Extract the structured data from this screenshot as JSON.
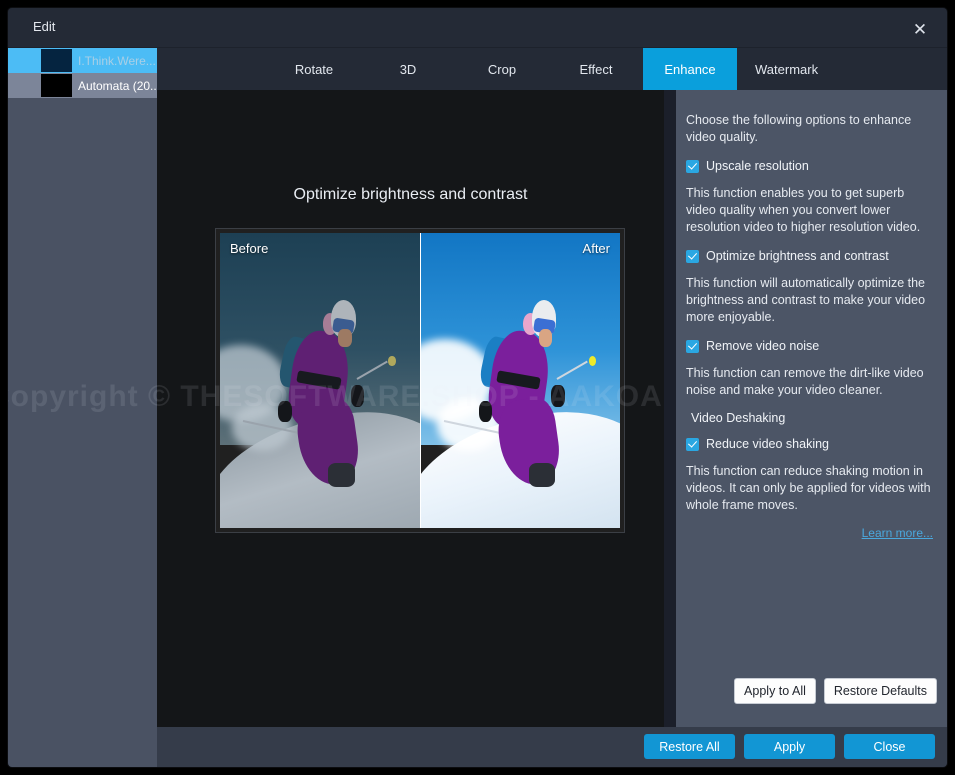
{
  "window": {
    "title": "Edit",
    "close_icon": "close-icon"
  },
  "sidebar": {
    "files": [
      {
        "name": "I.Think.Were...",
        "selected": true
      },
      {
        "name": "Automata (20...",
        "selected": false
      }
    ]
  },
  "tabs": [
    {
      "label": "Rotate",
      "active": false
    },
    {
      "label": "3D",
      "active": false
    },
    {
      "label": "Crop",
      "active": false
    },
    {
      "label": "Effect",
      "active": false
    },
    {
      "label": "Enhance",
      "active": true
    },
    {
      "label": "Watermark",
      "active": false
    }
  ],
  "preview": {
    "title": "Optimize brightness and contrast",
    "before_label": "Before",
    "after_label": "After",
    "watermark": "Copyright © THESOFTWARE.SHOP - AAKOA"
  },
  "panel": {
    "intro": "Choose the following options to enhance video quality.",
    "options": [
      {
        "label": "Upscale resolution",
        "checked": true,
        "description": "This function enables you to get superb video quality when you convert lower resolution video to higher resolution video."
      },
      {
        "label": "Optimize brightness and contrast",
        "checked": true,
        "description": "This function will automatically optimize the brightness and contrast to make your video more enjoyable."
      },
      {
        "label": "Remove video noise",
        "checked": true,
        "description": "This function can remove the dirt-like video noise and make your video cleaner."
      }
    ],
    "section_label": "Video Deshaking",
    "deshake": {
      "label": "Reduce video shaking",
      "checked": true,
      "description": "This function can reduce shaking motion in videos. It can only be applied for videos with whole frame moves."
    },
    "learn_more": "Learn more...",
    "apply_to_all": "Apply to All",
    "restore_defaults": "Restore Defaults"
  },
  "footer": {
    "restore_all": "Restore All",
    "apply": "Apply",
    "close": "Close"
  },
  "colors": {
    "accent": "#1296d4",
    "tab_active": "#0a9fdc",
    "checkbox": "#2aa7e2",
    "panel_bg": "#4c5566",
    "sidebar_bg": "#4a5263",
    "link": "#4aa8dd"
  }
}
